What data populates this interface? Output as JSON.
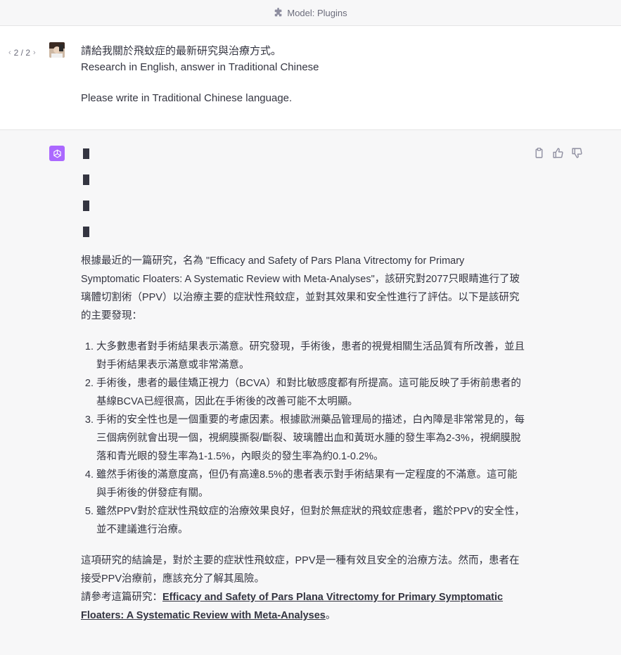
{
  "header": {
    "model_label": "Model: Plugins"
  },
  "user_message": {
    "pager": {
      "prev": "‹",
      "text": "2 / 2",
      "next": "›"
    },
    "line1": "請給我關於飛蚊症的最新研究與治療方式。",
    "line2": "Research in English, answer in Traditional Chinese",
    "line3": "Please write in Traditional Chinese language."
  },
  "assistant": {
    "intro": "根據最近的一篇研究，名為 \"Efficacy and Safety of Pars Plana Vitrectomy for Primary Symptomatic Floaters: A Systematic Review with Meta-Analyses\"，該研究對2077只眼睛進行了玻璃體切割術（PPV）以治療主要的症狀性飛蚊症，並對其效果和安全性進行了評估。以下是該研究的主要發現：",
    "findings": [
      "大多數患者對手術結果表示滿意。研究發現，手術後，患者的視覺相關生活品質有所改善，並且對手術結果表示滿意或非常滿意。",
      "手術後，患者的最佳矯正視力（BCVA）和對比敏感度都有所提高。這可能反映了手術前患者的基線BCVA已經很高，因此在手術後的改善可能不太明顯。",
      "手術的安全性也是一個重要的考慮因素。根據歐洲藥品管理局的描述，白內障是非常常見的，每三個病例就會出現一個，視網膜撕裂/斷裂、玻璃體出血和黃斑水腫的發生率為2-3%，視網膜脫落和青光眼的發生率為1-1.5%，內眼炎的發生率為約0.1-0.2%。",
      "雖然手術後的滿意度高，但仍有高達8.5%的患者表示對手術結果有一定程度的不滿意。這可能與手術後的併發症有關。",
      "雖然PPV對於症狀性飛蚊症的治療效果良好，但對於無症狀的飛蚊症患者，鑑於PPV的安全性，並不建議進行治療。"
    ],
    "conclusion": "這項研究的結論是，對於主要的症狀性飛蚊症，PPV是一種有效且安全的治療方法。然而，患者在接受PPV治療前，應該充分了解其風險。",
    "ref_prefix": "請參考這篇研究：",
    "ref_link": "Efficacy and Safety of Pars Plana Vitrectomy for Primary Symptomatic Floaters: A Systematic Review with Meta-Analyses",
    "ref_suffix": "。"
  },
  "colors": {
    "ai_avatar": "#ab68ff",
    "text": "#343541",
    "muted": "#6b6c7b"
  },
  "icons": [
    "puzzle-icon",
    "user-avatar",
    "openai-logo-icon",
    "copy-icon",
    "thumbs-up-icon",
    "thumbs-down-icon"
  ]
}
